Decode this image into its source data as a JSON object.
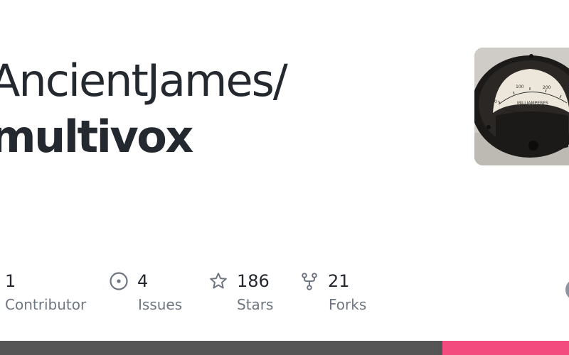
{
  "repo": {
    "owner": "AncientJames/",
    "name": "multivox"
  },
  "stats": [
    {
      "icon": "people-icon",
      "value": "1",
      "label": "Contributor"
    },
    {
      "icon": "issue-icon",
      "value": "4",
      "label": "Issues"
    },
    {
      "icon": "star-icon",
      "value": "186",
      "label": "Stars"
    },
    {
      "icon": "fork-icon",
      "value": "21",
      "label": "Forks"
    }
  ],
  "avatar": {
    "meter_label": "MILLIAMPERES",
    "scale": [
      "0",
      "100",
      "200"
    ],
    "icon": "meter-avatar-image"
  },
  "language_bar": [
    {
      "color": "#555555",
      "share": 0.777
    },
    {
      "color": "#f34b7d",
      "share": 0.223
    }
  ]
}
